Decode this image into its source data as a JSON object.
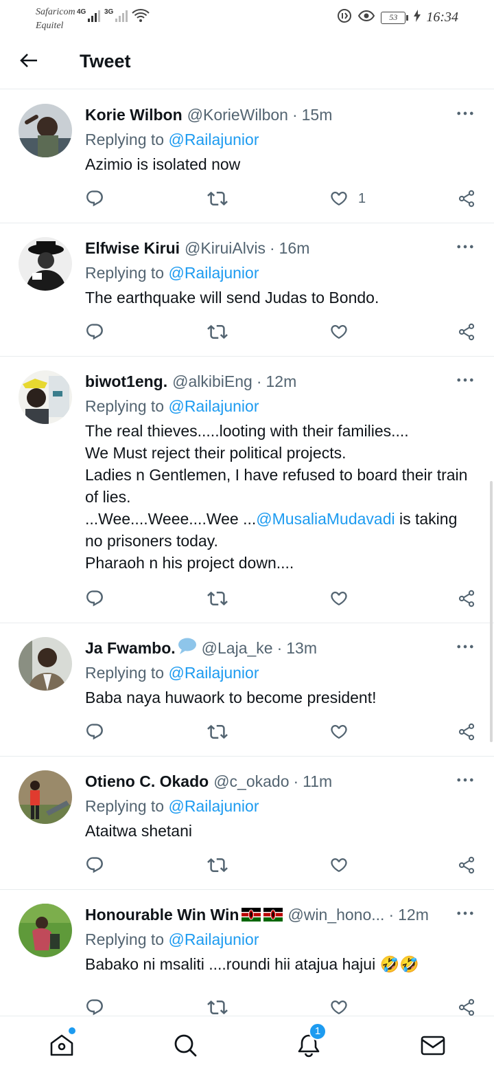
{
  "status_bar": {
    "carrier_1": "Safaricom",
    "carrier_2": "Equitel",
    "net_1": "4G",
    "net_2": "3G",
    "battery": "53",
    "time": "16:34"
  },
  "header": {
    "title": "Tweet"
  },
  "tweets": [
    {
      "name": "Korie Wilbon",
      "handle": "@KorieWilbon",
      "time": "15m",
      "replying_prefix": "Replying to ",
      "replying_to": "@Railajunior",
      "text": "Azimio is isolated now",
      "likes": "1"
    },
    {
      "name": "Elfwise Kirui",
      "handle": "@KiruiAlvis",
      "time": "16m",
      "replying_prefix": "Replying to ",
      "replying_to": "@Railajunior",
      "text": "The earthquake will send Judas to Bondo."
    },
    {
      "name": "biwot1eng.",
      "handle": "@alkibiEng",
      "time": "12m",
      "replying_prefix": "Replying to ",
      "replying_to": "@Railajunior",
      "text_1": "The real thieves.....looting with their families....\nWe Must reject their political projects.\nLadies n Gentlemen, I have refused to board their train of lies.\n...Wee....Weee....Wee ...",
      "mention": "@MusaliaMudavadi",
      "text_2": " is taking no prisoners today.\nPharaoh n his project down...."
    },
    {
      "name": "Ja Fwambo.",
      "handle": "@Laja_ke",
      "time": "13m",
      "replying_prefix": "Replying to ",
      "replying_to": "@Railajunior",
      "text": "Baba naya huwaork to become president!"
    },
    {
      "name": "Otieno C. Okado",
      "handle": "@c_okado",
      "time": "11m",
      "replying_prefix": "Replying to ",
      "replying_to": "@Railajunior",
      "text": "Ataitwa shetani"
    },
    {
      "name": "Honourable Win Win",
      "handle": "@win_hono...",
      "time": "12m",
      "replying_prefix": "Replying to ",
      "replying_to": "@Railajunior",
      "text": "Babako ni msaliti ....roundi hii atajua hajui 🤣🤣"
    }
  ],
  "bottom_nav": {
    "notifications_count": "1"
  },
  "colors": {
    "accent": "#1d9bf0",
    "text": "#0f1419",
    "secondary": "#536471",
    "divider": "#e8ecee"
  }
}
